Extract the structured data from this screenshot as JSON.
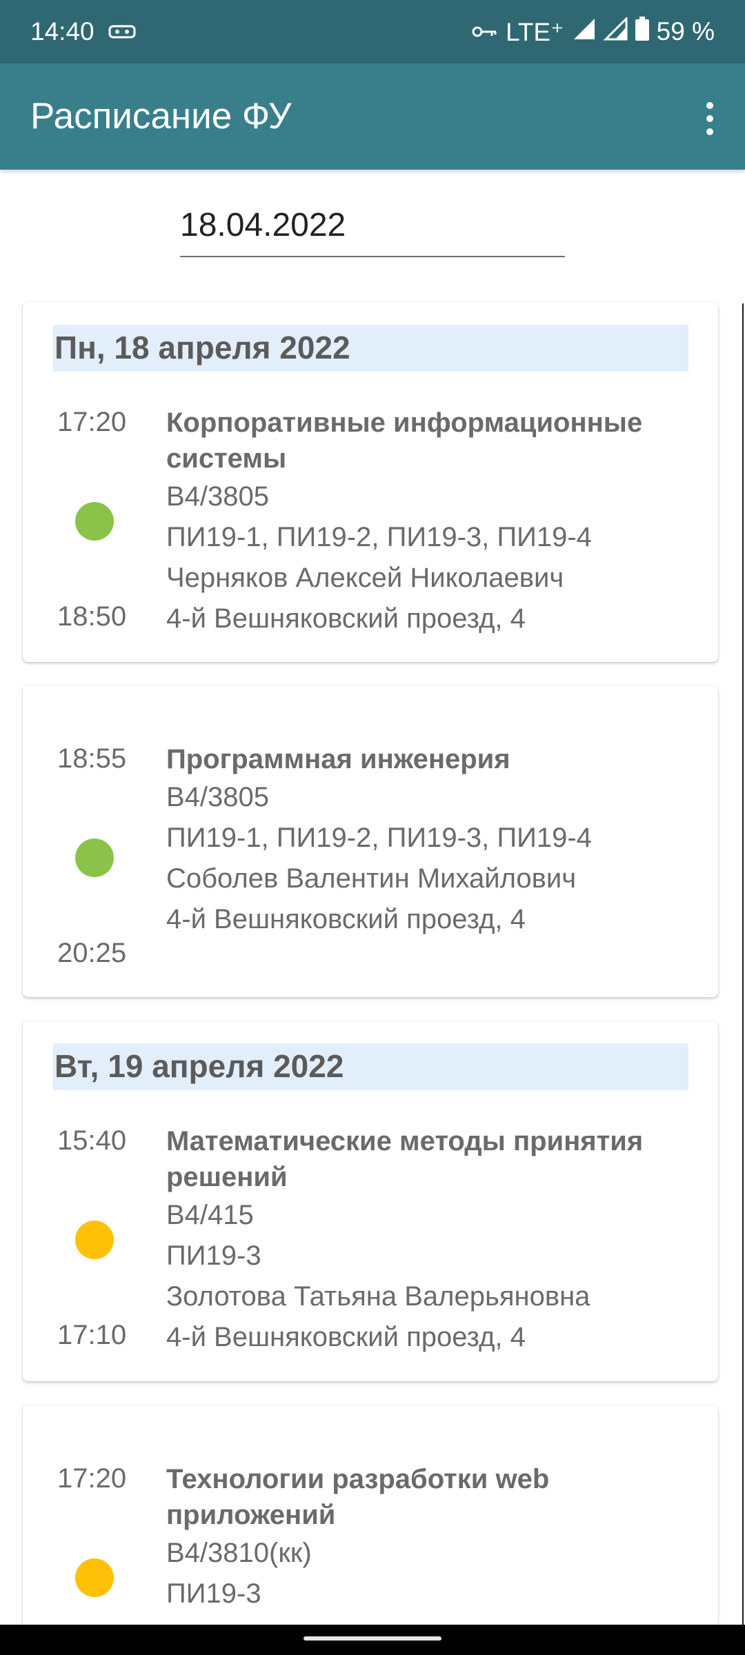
{
  "status_bar": {
    "time": "14:40",
    "network": "LTE⁺",
    "battery": "59 %"
  },
  "app_bar": {
    "title": "Расписание ФУ"
  },
  "date_input": {
    "value": "18.04.2022"
  },
  "days": [
    {
      "header": "Пн, 18 апреля 2022"
    },
    {
      "header": "Вт, 19 апреля 2022"
    }
  ],
  "lessons": [
    {
      "start": "17:20",
      "end": "18:50",
      "status_color": "#8bc34a",
      "subject": [
        "Корпоративные информационные",
        "системы"
      ],
      "room": "В4/3805",
      "groups": "ПИ19-1, ПИ19-2, ПИ19-3, ПИ19-4",
      "teacher": "Черняков Алексей Николаевич",
      "address": "4-й Вешняковский проезд, 4"
    },
    {
      "start": "18:55",
      "end": "20:25",
      "status_color": "#8bc34a",
      "subject": [
        "Программная инженерия"
      ],
      "room": "В4/3805",
      "groups": "ПИ19-1, ПИ19-2, ПИ19-3, ПИ19-4",
      "teacher": "Соболев Валентин Михайлович",
      "address": "4-й Вешняковский проезд, 4"
    },
    {
      "start": "15:40",
      "end": "17:10",
      "status_color": "#ffc107",
      "subject": [
        "Математические методы принятия",
        "решений"
      ],
      "room": "В4/415",
      "groups": "ПИ19-3",
      "teacher": "Золотова Татьяна Валерьяновна",
      "address": "4-й Вешняковский проезд, 4"
    },
    {
      "start": "17:20",
      "status_color": "#ffc107",
      "subject": [
        "Технологии разработки web",
        "приложений"
      ],
      "room": "В4/3810(кк)",
      "groups": "ПИ19-3"
    }
  ]
}
